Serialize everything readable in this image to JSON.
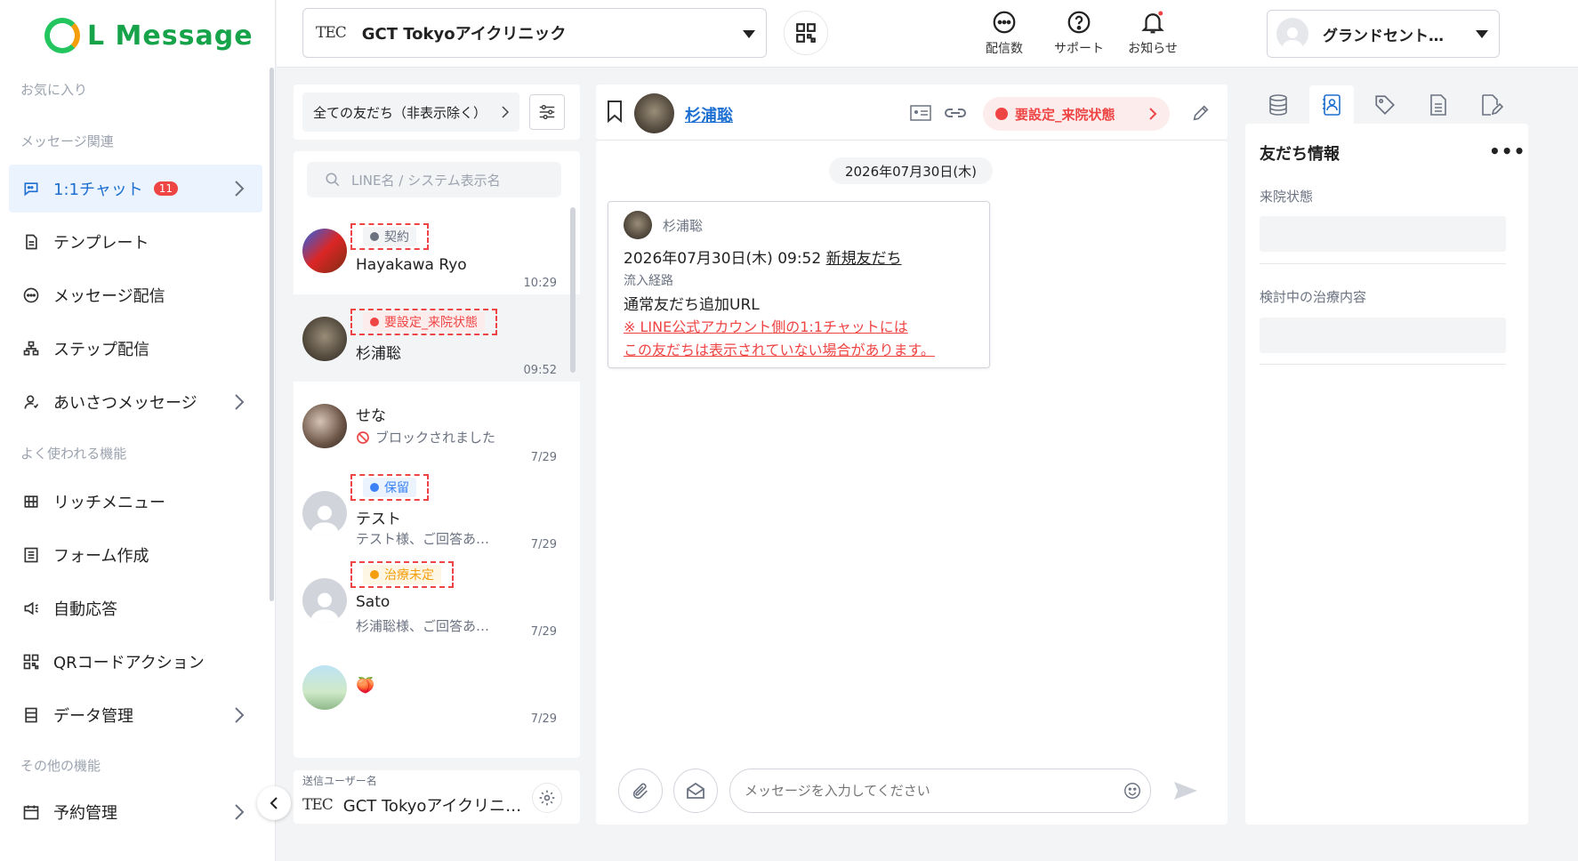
{
  "app": {
    "name": "L Message"
  },
  "sidebar": {
    "sections": {
      "favorites": "お気に入り",
      "message": "メッセージ関連",
      "frequent": "よく使われる機能",
      "other": "その他の機能"
    },
    "items": [
      {
        "label": "1:1チャット",
        "badge": "11",
        "icon": "chat-icon"
      },
      {
        "label": "テンプレート",
        "icon": "document-icon"
      },
      {
        "label": "メッセージ配信",
        "icon": "message-icon"
      },
      {
        "label": "ステップ配信",
        "icon": "hierarchy-icon"
      },
      {
        "label": "あいさつメッセージ",
        "icon": "user-icon"
      },
      {
        "label": "リッチメニュー",
        "icon": "grid-icon"
      },
      {
        "label": "フォーム作成",
        "icon": "form-icon"
      },
      {
        "label": "自動応答",
        "icon": "speaker-icon"
      },
      {
        "label": "QRコードアクション",
        "icon": "qr-icon"
      },
      {
        "label": "データ管理",
        "icon": "data-icon"
      },
      {
        "label": "予約管理",
        "icon": "calendar-icon"
      }
    ]
  },
  "topbar": {
    "account_logo": "TEC",
    "account_name": "GCT Tokyoアイクリニック",
    "icons": [
      {
        "label": "配信数",
        "icon": "message-count-icon"
      },
      {
        "label": "サポート",
        "icon": "help-icon"
      },
      {
        "label": "お知らせ",
        "icon": "bell-icon"
      }
    ],
    "user_name": "グランドセント…"
  },
  "friends": {
    "filter_label": "全ての友だち（非表示除く）",
    "search_placeholder": "LINE名 / システム表示名",
    "list": [
      {
        "name": "Hayakawa Ryo",
        "tag": "契約",
        "tag_color": "#9ca3af",
        "time": "10:29",
        "sub": ""
      },
      {
        "name": "杉浦聡",
        "tag": "要設定_来院状態",
        "tag_color": "#ef4444",
        "time": "09:52",
        "sub": ""
      },
      {
        "name": "せな",
        "tag": "",
        "tag_color": "",
        "time": "7/29",
        "sub": "ブロックされました"
      },
      {
        "name": "テスト",
        "tag": "保留",
        "tag_color": "#3b82f6",
        "time": "7/29",
        "sub": "テスト様、ご回答あ…"
      },
      {
        "name": "Sato",
        "tag": "治療未定",
        "tag_color": "#f59e0b",
        "time": "7/29",
        "sub": "杉浦聡様、ご回答あ…"
      },
      {
        "name": "🍑",
        "tag": "",
        "tag_color": "",
        "time": "7/29",
        "sub": ""
      }
    ],
    "sender_label": "送信ユーザー名",
    "sender_name": "GCT Tokyoアイクリニ…",
    "sender_logo": "TEC"
  },
  "chat": {
    "name": "杉浦聡",
    "status": "要設定_来院状態",
    "date": "2026年07月30日(木)",
    "message": {
      "sender": "杉浦聡",
      "line1_prefix": "2026年07月30日(木) 09:52 ",
      "line1_link": "新規友だち",
      "route_label": "流入経路",
      "route_value": "通常友だち追加URL",
      "warning1": "※ LINE公式アカウント側の1:1チャットには",
      "warning2": "この友だちは表示されていない場合があります。"
    },
    "input_placeholder": "メッセージを入力してください"
  },
  "info": {
    "title": "友だち情報",
    "more": "•••",
    "fields": [
      {
        "label": "来院状態",
        "value": ""
      },
      {
        "label": "検討中の治療内容",
        "value": ""
      }
    ]
  },
  "colors": {
    "accent": "#1d6fd1",
    "brand": "#16a34a",
    "alert": "#ef4444"
  }
}
